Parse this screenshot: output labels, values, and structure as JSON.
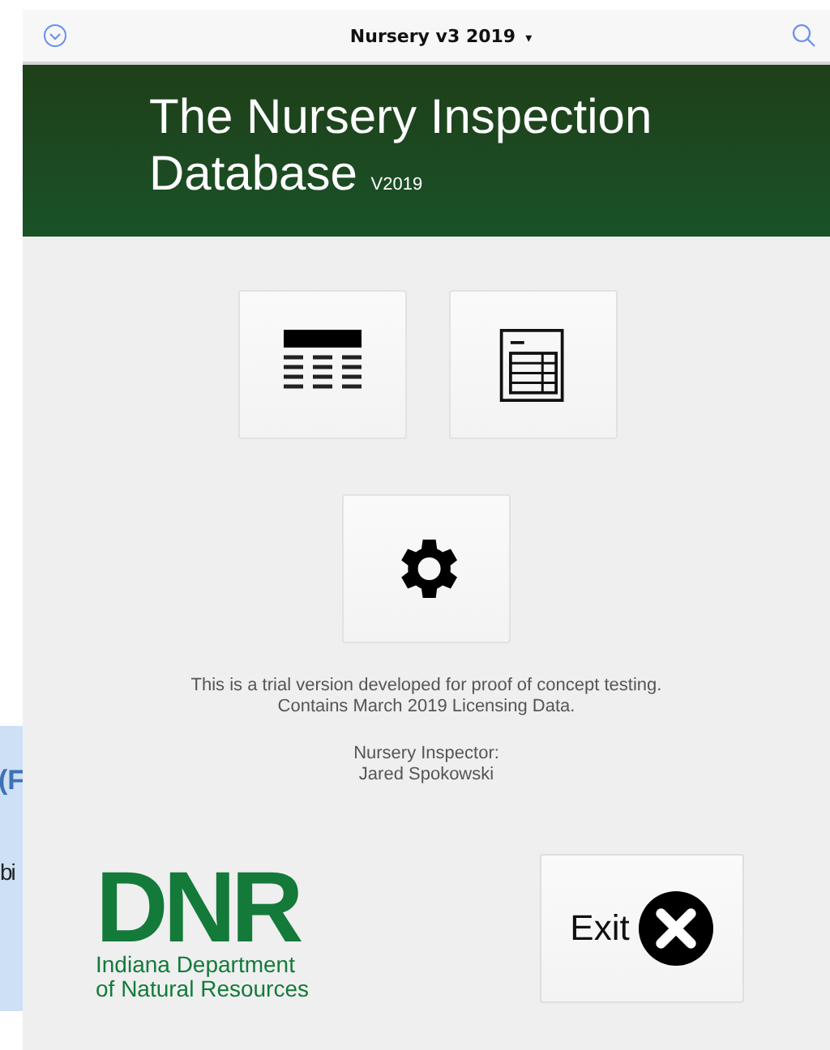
{
  "background_window": {
    "texts": [
      "(F",
      "bi"
    ]
  },
  "nav_bar": {
    "title": "Nursery v3 2019",
    "caret": "▾"
  },
  "banner": {
    "title_line1": "The Nursery Inspection",
    "title_line2": "Database",
    "version": "V2019"
  },
  "tiles": [
    {
      "kind": "list"
    },
    {
      "kind": "form"
    },
    {
      "kind": "settings"
    }
  ],
  "notice": [
    "This is a trial version developed for proof of concept testing.",
    "Contains March 2019 Licensing Data."
  ],
  "inspector": {
    "label": "Nursery Inspector:",
    "name": "Jared Spokowski"
  },
  "logo": {
    "mark": "DNR",
    "line1": "Indiana Department",
    "line2": "of Natural Resources"
  },
  "exit_button": {
    "label": "Exit"
  }
}
